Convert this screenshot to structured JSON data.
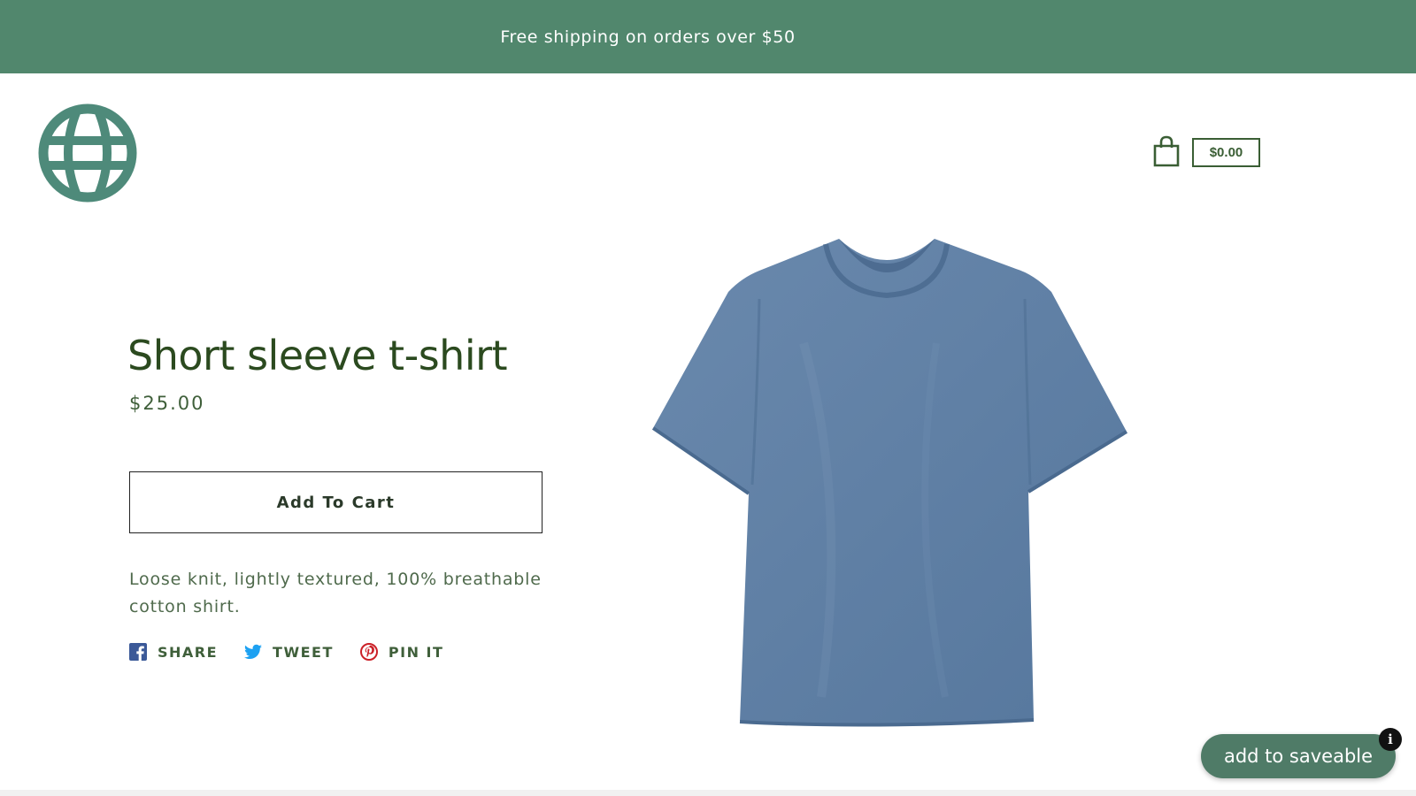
{
  "announcement": {
    "text": "Free shipping on orders over $50"
  },
  "header": {
    "logo_icon": "globe-icon",
    "cart_icon": "shopping-bag-icon",
    "cart_total": "$0.00"
  },
  "product": {
    "title": "Short sleeve t-shirt",
    "price": "$25.00",
    "add_to_cart_label": "Add To Cart",
    "description": "Loose knit, lightly textured, 100% breathable cotton shirt.",
    "image_subject": "blue short sleeve t-shirt"
  },
  "social": [
    {
      "label": "SHARE",
      "icon": "facebook-icon",
      "color": "#3b5998"
    },
    {
      "label": "TWEET",
      "icon": "twitter-icon",
      "color": "#1da1f2"
    },
    {
      "label": "PIN IT",
      "icon": "pinterest-icon",
      "color": "#cb2027"
    }
  ],
  "saveable": {
    "label": "add to saveable",
    "info_icon": "info-icon"
  },
  "colors": {
    "brand_green": "#51876d",
    "title_green": "#2b4a1f",
    "logo_teal": "#4e8a7a",
    "shirt_blue": "#5e7fa5"
  }
}
